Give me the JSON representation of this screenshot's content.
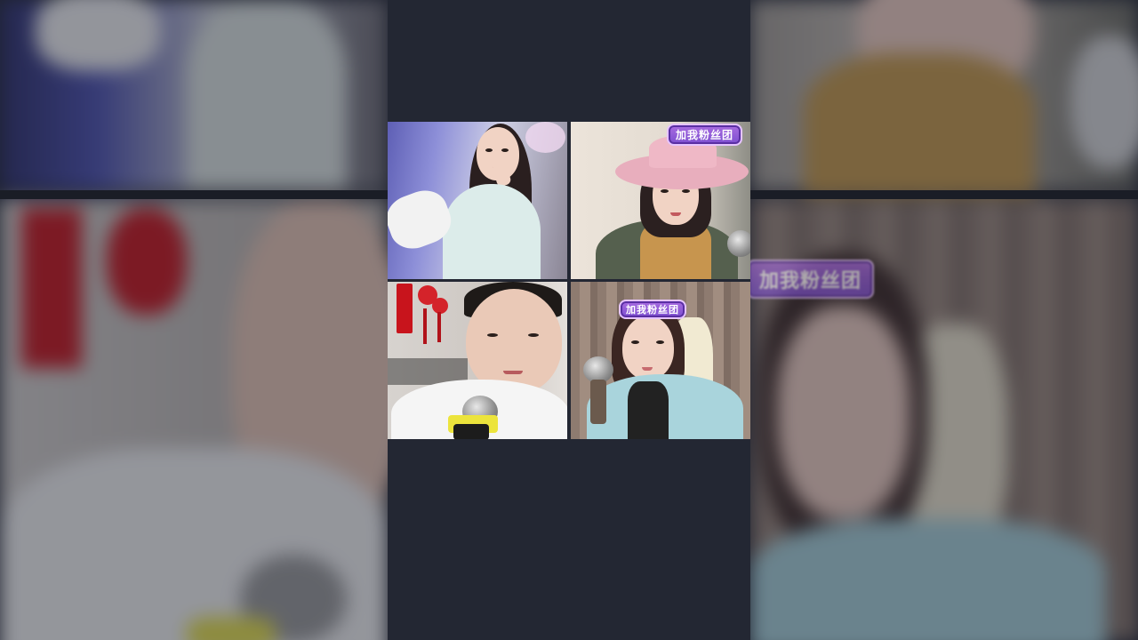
{
  "video_grid": {
    "tiles": [
      {
        "id": "streamer-1",
        "badge": ""
      },
      {
        "id": "streamer-2",
        "badge": "加我粉丝团"
      },
      {
        "id": "streamer-3",
        "badge": ""
      },
      {
        "id": "streamer-4",
        "badge": "加我粉丝团"
      }
    ]
  },
  "backdrop": {
    "right_bottom_badge": "加我粉丝团"
  },
  "colors": {
    "page_background": "#1f2330",
    "badge_fill": "#8a5bd8",
    "badge_border": "#e6c4ff"
  }
}
